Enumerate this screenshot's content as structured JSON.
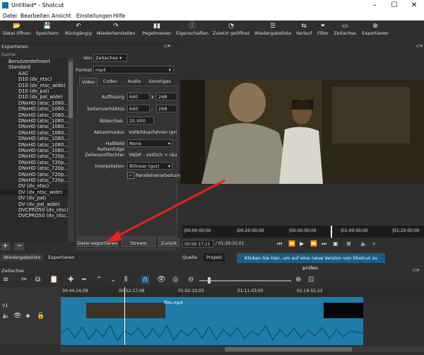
{
  "window": {
    "title": "Untitled* - Shotcut",
    "controls": [
      "–",
      "☐",
      "✕"
    ]
  },
  "menu": [
    "Datei",
    "Bearbeiten",
    "Ansicht",
    "Einstellungen",
    "Hilfe"
  ],
  "toolbar": [
    {
      "label": "Datei öffnen",
      "icon": "folder-open-icon",
      "glyph": "📂"
    },
    {
      "label": "Speichern",
      "icon": "save-icon",
      "glyph": "💾"
    },
    {
      "label": "Rückgängig",
      "icon": "undo-icon",
      "glyph": "↶"
    },
    {
      "label": "Wiederherstellen",
      "icon": "redo-icon",
      "glyph": "↷"
    },
    {
      "label": "Pegelmesser",
      "icon": "meter-icon",
      "glyph": "▮▮"
    },
    {
      "label": "Eigenschaften",
      "icon": "info-icon",
      "glyph": "ⓘ"
    },
    {
      "label": "Zuletzt geöffnet",
      "icon": "recent-icon",
      "glyph": "◔"
    },
    {
      "label": "Wiedergabeliste",
      "icon": "playlist-icon",
      "glyph": "☰"
    },
    {
      "label": "Verlauf",
      "icon": "history-icon",
      "glyph": "⇆"
    },
    {
      "label": "Filter",
      "icon": "filter-icon",
      "glyph": "⏷"
    },
    {
      "label": "Zeitachse",
      "icon": "timeline-icon",
      "glyph": "▭"
    },
    {
      "label": "Exportieren",
      "icon": "export-icon",
      "glyph": "⊕"
    }
  ],
  "export": {
    "panel_title": "Exportieren",
    "search_placeholder": "Suche",
    "presets": [
      "Benutzerdefiniert",
      "Standard",
      "AAC",
      "D10 (dv_ntsc)",
      "D10 (dv_ntsc_wide)",
      "D10 (dv_pal)",
      "D10 (dv_pal_wide)",
      "DNxHD (atsc_1080...",
      "DNxHD (atsc_1080...",
      "DNxHD (atsc_1080...",
      "DNxHD (atsc_1080...",
      "DNxHD (atsc_1080...",
      "DNxHD (atsc_1080...",
      "DNxHD (atsc_1080...",
      "DNxHD (atsc_1080...",
      "DNxHD (atsc_1080...",
      "DNxHD (atsc_720p...",
      "DNxHD (atsc_720p...",
      "DNxHD (atsc_720p...",
      "DNxHD (atsc_720p...",
      "DNxHD (atsc_720p...",
      "DV (dv_ntsc)",
      "DV (dv_ntsc_wide)",
      "DV (dv_pal)",
      "DV (dv_pal_wide)",
      "DVCPRO50 (dv_ntsc)",
      "DVCPRO50 (dv_ntsc..."
    ],
    "from_label": "Von",
    "from_value": "Zeitachse",
    "format_label": "Format",
    "format_value": "mp4",
    "tabs": [
      "Video",
      "Codec",
      "Audio",
      "Sonstiges"
    ],
    "fields": {
      "resolution_label": "Auflösung",
      "res_w": "640",
      "res_h": "268",
      "aspect_label": "Seitenverhältnis",
      "asp_w": "640",
      "asp_h": "268",
      "fps_label": "Bilder/Sek.",
      "fps": "25.000",
      "scan_label": "Abtastmodus",
      "scan": "Vollbildverfahren (pro",
      "field_label": "Halbbild Reihenfolge",
      "field": "None",
      "deint_label": "Zeilenentflechter",
      "deint": "YADIF - zeitlich + räu",
      "interp_label": "Interpolation",
      "interp": "Bilinear (gut)",
      "parallel_label": "Parallelverarbeitung"
    },
    "buttons": {
      "export_file": "Datei exportieren",
      "stream": "Stream",
      "reset": "Zurück"
    },
    "left_tabs": [
      "Wiedergabeliste",
      "Exportieren"
    ]
  },
  "player": {
    "timecodes": [
      "|00:00:00;00",
      "|00:20:00;00",
      "|00:40:00;00",
      "|01:00:00;00",
      "|01:20:00;00"
    ],
    "current": "00:56:17;11",
    "total": "/ 01:29:31;01",
    "tabs": [
      "Quelle",
      "Projekt"
    ],
    "notice": "Klicken Sie hier, um auf eine neue Version von Shotcut zu prüfen."
  },
  "timeline": {
    "title": "Zeitachse",
    "track": "V1",
    "ticks": [
      "00:44:24;09",
      "00:52:17;06",
      "01:02:10;03",
      "01:11:03;00",
      "01:19:55;22"
    ],
    "clip": "film.mp4"
  },
  "colors": {
    "accent": "#1a5d85",
    "track": "#1d7ca8",
    "arrow": "#e8221b"
  }
}
